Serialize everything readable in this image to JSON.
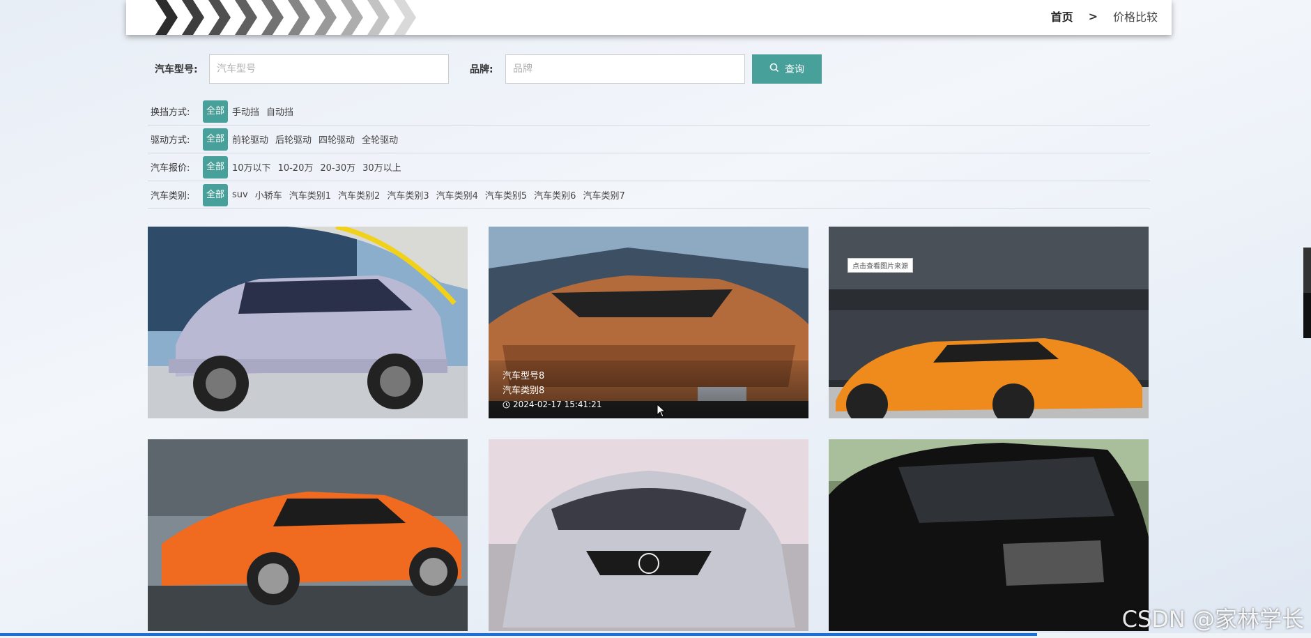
{
  "header": {
    "breadcrumb_home": "首页",
    "breadcrumb_sep": ">",
    "breadcrumb_current": "价格比较"
  },
  "search": {
    "model_label": "汽车型号:",
    "model_placeholder": "汽车型号",
    "brand_label": "品牌:",
    "brand_placeholder": "品牌",
    "button_label": "查询"
  },
  "filters": [
    {
      "label": "换挡方式:",
      "options": [
        "全部",
        "手动挡",
        "自动挡"
      ],
      "active": 0
    },
    {
      "label": "驱动方式:",
      "options": [
        "全部",
        "前轮驱动",
        "后轮驱动",
        "四轮驱动",
        "全轮驱动"
      ],
      "active": 0
    },
    {
      "label": "汽车报价:",
      "options": [
        "全部",
        "10万以下",
        "10-20万",
        "20-30万",
        "30万以上"
      ],
      "active": 0
    },
    {
      "label": "汽车类别:",
      "options": [
        "全部",
        "suv",
        "小轿车",
        "汽车类别1",
        "汽车类别2",
        "汽车类别3",
        "汽车类别4",
        "汽车类别5",
        "汽车类别6",
        "汽车类别7"
      ],
      "active": 0
    }
  ],
  "cards": [
    {
      "kind": "suv-silver",
      "hover": false
    },
    {
      "kind": "lambo-orange",
      "hover": true,
      "model": "汽车型号8",
      "category": "汽车类别8",
      "time": "2024-02-17 15:41:21"
    },
    {
      "kind": "mclaren-orange",
      "hover": false,
      "tag": "点击查看图片来源"
    },
    {
      "kind": "sedan-orange",
      "hover": false
    },
    {
      "kind": "nissan-silver",
      "hover": false
    },
    {
      "kind": "van-black",
      "hover": false
    }
  ],
  "watermark": "CSDN @家林学长",
  "colors": {
    "accent": "#48a09b",
    "progress": "#1d6fd8"
  },
  "icons": {
    "search": "search-icon",
    "clock": "clock-icon"
  }
}
